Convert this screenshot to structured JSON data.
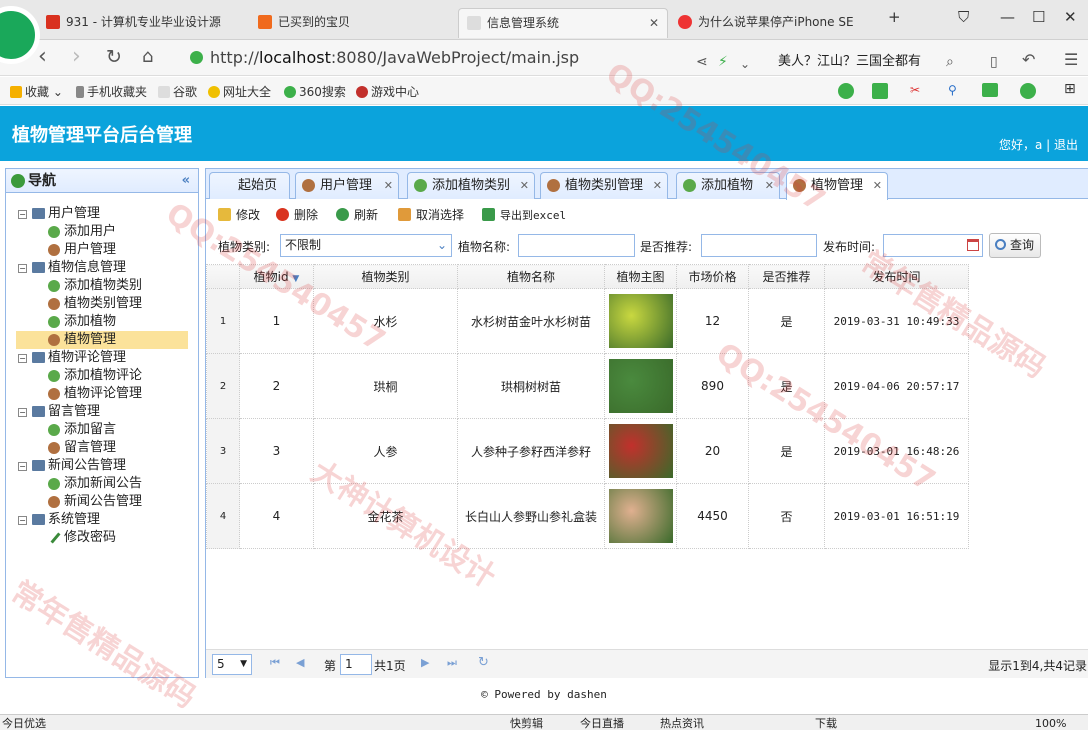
{
  "browser": {
    "tabs": [
      {
        "label": "931 - 计算机专业毕业设计源"
      },
      {
        "label": "已买到的宝贝"
      },
      {
        "label": "信息管理系统"
      },
      {
        "label": "为什么说苹果停产iPhone SE"
      }
    ],
    "url_prefix": "http://",
    "url_host": "localhost",
    "url_rest": ":8080/JavaWebProject/main.jsp",
    "search_text": "美人？江山？三国全都有",
    "bookmarks": [
      "收藏",
      "手机收藏夹",
      "谷歌",
      "网址大全",
      "360搜索",
      "游戏中心"
    ]
  },
  "header": {
    "title": "植物管理平台后台管理",
    "user": "您好，a",
    "logout": "退出"
  },
  "sidebar": {
    "title": "导航",
    "groups": [
      {
        "label": "用户管理",
        "items": [
          "添加用户",
          "用户管理"
        ]
      },
      {
        "label": "植物信息管理",
        "items": [
          "添加植物类别",
          "植物类别管理",
          "添加植物",
          "植物管理"
        ]
      },
      {
        "label": "植物评论管理",
        "items": [
          "添加植物评论",
          "植物评论管理"
        ]
      },
      {
        "label": "留言管理",
        "items": [
          "添加留言",
          "留言管理"
        ]
      },
      {
        "label": "新闻公告管理",
        "items": [
          "添加新闻公告",
          "新闻公告管理"
        ]
      },
      {
        "label": "系统管理",
        "items": [
          "修改密码"
        ]
      }
    ]
  },
  "page_tabs": [
    "起始页",
    "用户管理",
    "添加植物类别",
    "植物类别管理",
    "添加植物",
    "植物管理"
  ],
  "toolbar": {
    "edit": "修改",
    "delete": "删除",
    "refresh": "刷新",
    "cancel_select": "取消选择",
    "export": "导出到excel"
  },
  "search": {
    "category_label": "植物类别:",
    "category_value": "不限制",
    "name_label": "植物名称:",
    "name_value": "",
    "recommend_label": "是否推荐:",
    "recommend_value": "",
    "date_label": "发布时间:",
    "date_value": "",
    "query": "查询"
  },
  "table": {
    "columns": [
      "植物id",
      "植物类别",
      "植物名称",
      "植物主图",
      "市场价格",
      "是否推荐",
      "发布时间"
    ],
    "rows": [
      {
        "n": "1",
        "id": "1",
        "category": "水杉",
        "name": "水杉树苗金叶水杉树苗",
        "price": "12",
        "recommend": "是",
        "date": "2019-03-31 10:49:33",
        "img_color": "#c9d840"
      },
      {
        "n": "2",
        "id": "2",
        "category": "珙桐",
        "name": "珙桐树树苗",
        "price": "890",
        "recommend": "是",
        "date": "2019-04-06 20:57:17",
        "img_color": "#4a8a3e"
      },
      {
        "n": "3",
        "id": "3",
        "category": "人参",
        "name": "人参种子参籽西洋参籽",
        "price": "20",
        "recommend": "是",
        "date": "2019-03-01 16:48:26",
        "img_color": "#c2302c"
      },
      {
        "n": "4",
        "id": "4",
        "category": "金花茶",
        "name": "长白山人参野山参礼盒装",
        "price": "4450",
        "recommend": "否",
        "date": "2019-03-01 16:51:19",
        "img_color": "#e0b090"
      }
    ]
  },
  "pager": {
    "size": "5",
    "page_prefix": "第",
    "page": "1",
    "page_suffix": "共1页",
    "summary": "显示1到4,共4记录"
  },
  "footer": "© Powered by dashen",
  "statusbar": [
    "今日优选",
    "快剪辑",
    "今日直播",
    "热点资讯",
    "下载",
    "100%"
  ],
  "watermarks": [
    "QQ:254540457",
    "常年售精品源码",
    "大神计算机设计"
  ]
}
